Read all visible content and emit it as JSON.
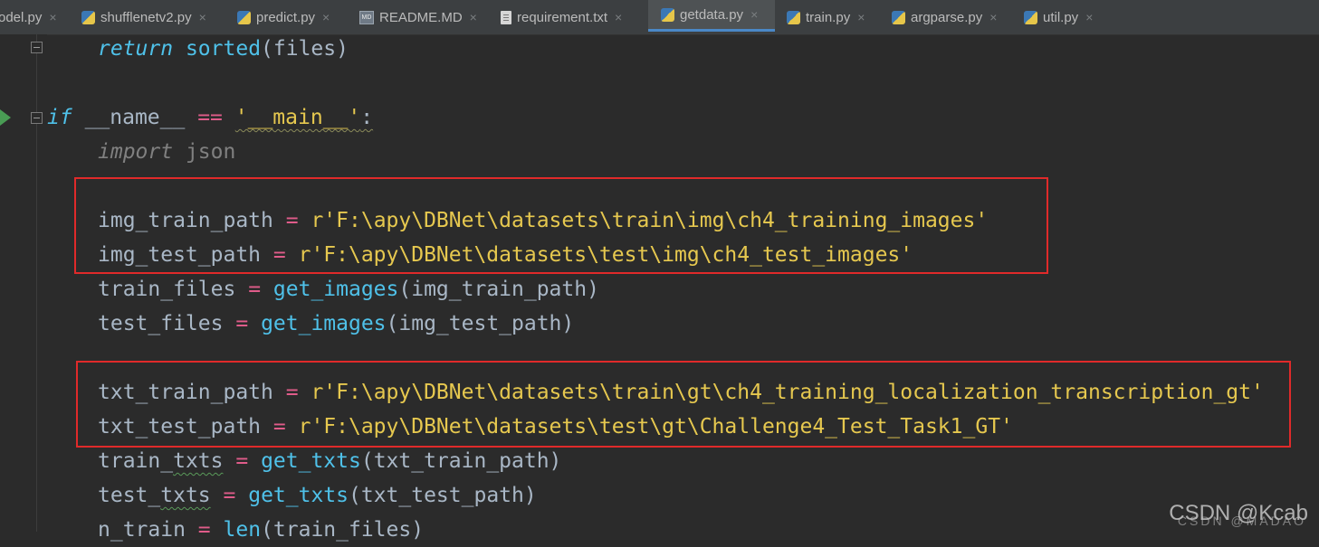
{
  "tabs": [
    {
      "label": "odel.py",
      "icon": "python-file-icon"
    },
    {
      "label": "shufflenetv2.py",
      "icon": "python-file-icon"
    },
    {
      "label": "predict.py",
      "icon": "python-file-icon"
    },
    {
      "label": "README.MD",
      "icon": "markdown-file-icon"
    },
    {
      "label": "requirement.txt",
      "icon": "text-file-icon"
    },
    {
      "label": "getdata.py",
      "icon": "python-file-icon",
      "active": true
    },
    {
      "label": "train.py",
      "icon": "python-file-icon"
    },
    {
      "label": "argparse.py",
      "icon": "python-file-icon"
    },
    {
      "label": "util.py",
      "icon": "python-file-icon"
    }
  ],
  "close_glyph": "×",
  "code": {
    "l1": {
      "kw": "return",
      "fn": "sorted",
      "rest": "(files)"
    },
    "l3": {
      "kw": "if",
      "name": "__name__",
      "op": "==",
      "str": "'__main__'",
      "colon": ":"
    },
    "l4": {
      "kw": "import",
      "mod": "json"
    },
    "l6": {
      "var": "img_train_path",
      "op": "=",
      "str": "r'F:\\apy\\DBNet\\datasets\\train\\img\\ch4_training_images'"
    },
    "l7": {
      "var": "img_test_path",
      "op": "=",
      "str": "r'F:\\apy\\DBNet\\datasets\\test\\img\\ch4_test_images'"
    },
    "l8": {
      "var": "train_files",
      "op": "=",
      "fn": "get_images",
      "args": "(img_train_path)"
    },
    "l9": {
      "var": "test_files",
      "op": "=",
      "fn": "get_images",
      "args": "(img_test_path)"
    },
    "l11": {
      "var": "txt_train_path",
      "op": "=",
      "str": "r'F:\\apy\\DBNet\\datasets\\train\\gt\\ch4_training_localization_transcription_gt'"
    },
    "l12": {
      "var": "txt_test_path",
      "op": "=",
      "str": "r'F:\\apy\\DBNet\\datasets\\test\\gt\\Challenge4_Test_Task1_GT'"
    },
    "l13": {
      "var_a": "train_",
      "var_b": "txts",
      "op": "=",
      "fn": "get_txts",
      "args": "(txt_train_path)"
    },
    "l14": {
      "var_a": "test_",
      "var_b": "txts",
      "op": "=",
      "fn": "get_txts",
      "args": "(txt_test_path)"
    },
    "l15": {
      "var": "n_train",
      "op": "=",
      "fn": "len",
      "args": "(train_files)"
    }
  },
  "watermark": {
    "main": "CSDN @Kcab",
    "sub": "CSDN @MADAO"
  },
  "colors": {
    "highlight_box": "#e02a2a",
    "active_tab_underline": "#4a88c7",
    "run_gutter": "#499c54"
  }
}
